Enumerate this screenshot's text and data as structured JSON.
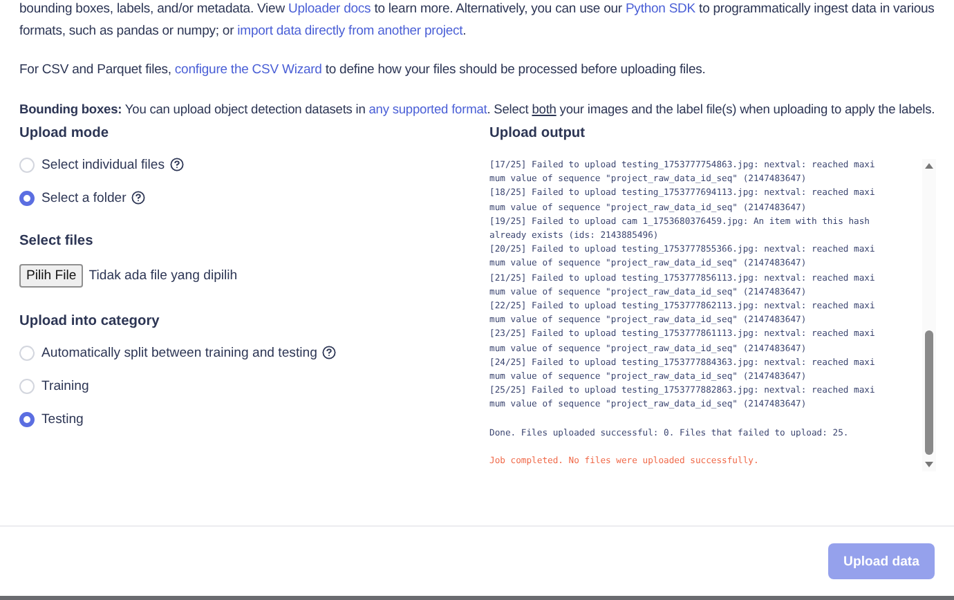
{
  "intro": [
    {
      "segments": [
        {
          "kind": "text",
          "text": "bounding boxes, labels, and/or metadata. View "
        },
        {
          "kind": "link",
          "text": "Uploader docs"
        },
        {
          "kind": "text",
          "text": " to learn more. Alternatively, you can use our "
        },
        {
          "kind": "link",
          "text": "Python SDK"
        },
        {
          "kind": "text",
          "text": " to programmatically ingest data in various formats, such as pandas or numpy; or "
        },
        {
          "kind": "link",
          "text": "import data directly from another project"
        },
        {
          "kind": "text",
          "text": "."
        }
      ]
    },
    {
      "segments": [
        {
          "kind": "text",
          "text": "For CSV and Parquet files, "
        },
        {
          "kind": "link",
          "text": "configure the CSV Wizard"
        },
        {
          "kind": "text",
          "text": " to define how your files should be processed before uploading files."
        }
      ]
    },
    {
      "segments": [
        {
          "kind": "bold",
          "text": "Bounding boxes:"
        },
        {
          "kind": "text",
          "text": " You can upload object detection datasets in "
        },
        {
          "kind": "link",
          "text": "any supported format"
        },
        {
          "kind": "text",
          "text": ". Select "
        },
        {
          "kind": "underline",
          "text": "both"
        },
        {
          "kind": "text",
          "text": " your images and the label file(s) when uploading to apply the labels."
        }
      ]
    }
  ],
  "upload_mode": {
    "title": "Upload mode",
    "options": [
      {
        "label": "Select individual files",
        "help": true,
        "selected": false
      },
      {
        "label": "Select a folder",
        "help": true,
        "selected": true
      }
    ]
  },
  "select_files": {
    "title": "Select files",
    "button": "Pilih File",
    "status": "Tidak ada file yang dipilih"
  },
  "category": {
    "title": "Upload into category",
    "options": [
      {
        "label": "Automatically split between training and testing",
        "help": true,
        "selected": false
      },
      {
        "label": "Training",
        "help": false,
        "selected": false
      },
      {
        "label": "Testing",
        "help": false,
        "selected": true
      }
    ]
  },
  "output": {
    "title": "Upload output",
    "lines": [
      {
        "kind": "log",
        "text": "[17/25] Failed to upload testing_1753777754863.jpg: nextval: reached maximum value of sequence \"project_raw_data_id_seq\" (2147483647)"
      },
      {
        "kind": "log",
        "text": "[18/25] Failed to upload testing_1753777694113.jpg: nextval: reached maximum value of sequence \"project_raw_data_id_seq\" (2147483647)"
      },
      {
        "kind": "log",
        "text": "[19/25] Failed to upload cam 1_1753680376459.jpg: An item with this hash already exists (ids: 2143885496)"
      },
      {
        "kind": "log",
        "text": "[20/25] Failed to upload testing_1753777855366.jpg: nextval: reached maximum value of sequence \"project_raw_data_id_seq\" (2147483647)"
      },
      {
        "kind": "log",
        "text": "[21/25] Failed to upload testing_1753777856113.jpg: nextval: reached maximum value of sequence \"project_raw_data_id_seq\" (2147483647)"
      },
      {
        "kind": "log",
        "text": "[22/25] Failed to upload testing_1753777862113.jpg: nextval: reached maximum value of sequence \"project_raw_data_id_seq\" (2147483647)"
      },
      {
        "kind": "log",
        "text": "[23/25] Failed to upload testing_1753777861113.jpg: nextval: reached maximum value of sequence \"project_raw_data_id_seq\" (2147483647)"
      },
      {
        "kind": "log",
        "text": "[24/25] Failed to upload testing_1753777884363.jpg: nextval: reached maximum value of sequence \"project_raw_data_id_seq\" (2147483647)"
      },
      {
        "kind": "log",
        "text": "[25/25] Failed to upload testing_1753777882863.jpg: nextval: reached maximum value of sequence \"project_raw_data_id_seq\" (2147483647)"
      },
      {
        "kind": "summary",
        "text": "Done. Files uploaded successful: 0. Files that failed to upload: 25."
      },
      {
        "kind": "error",
        "text": "Job completed. No files were uploaded successfully."
      }
    ]
  },
  "footer": {
    "button": "Upload data",
    "disabled": true
  }
}
